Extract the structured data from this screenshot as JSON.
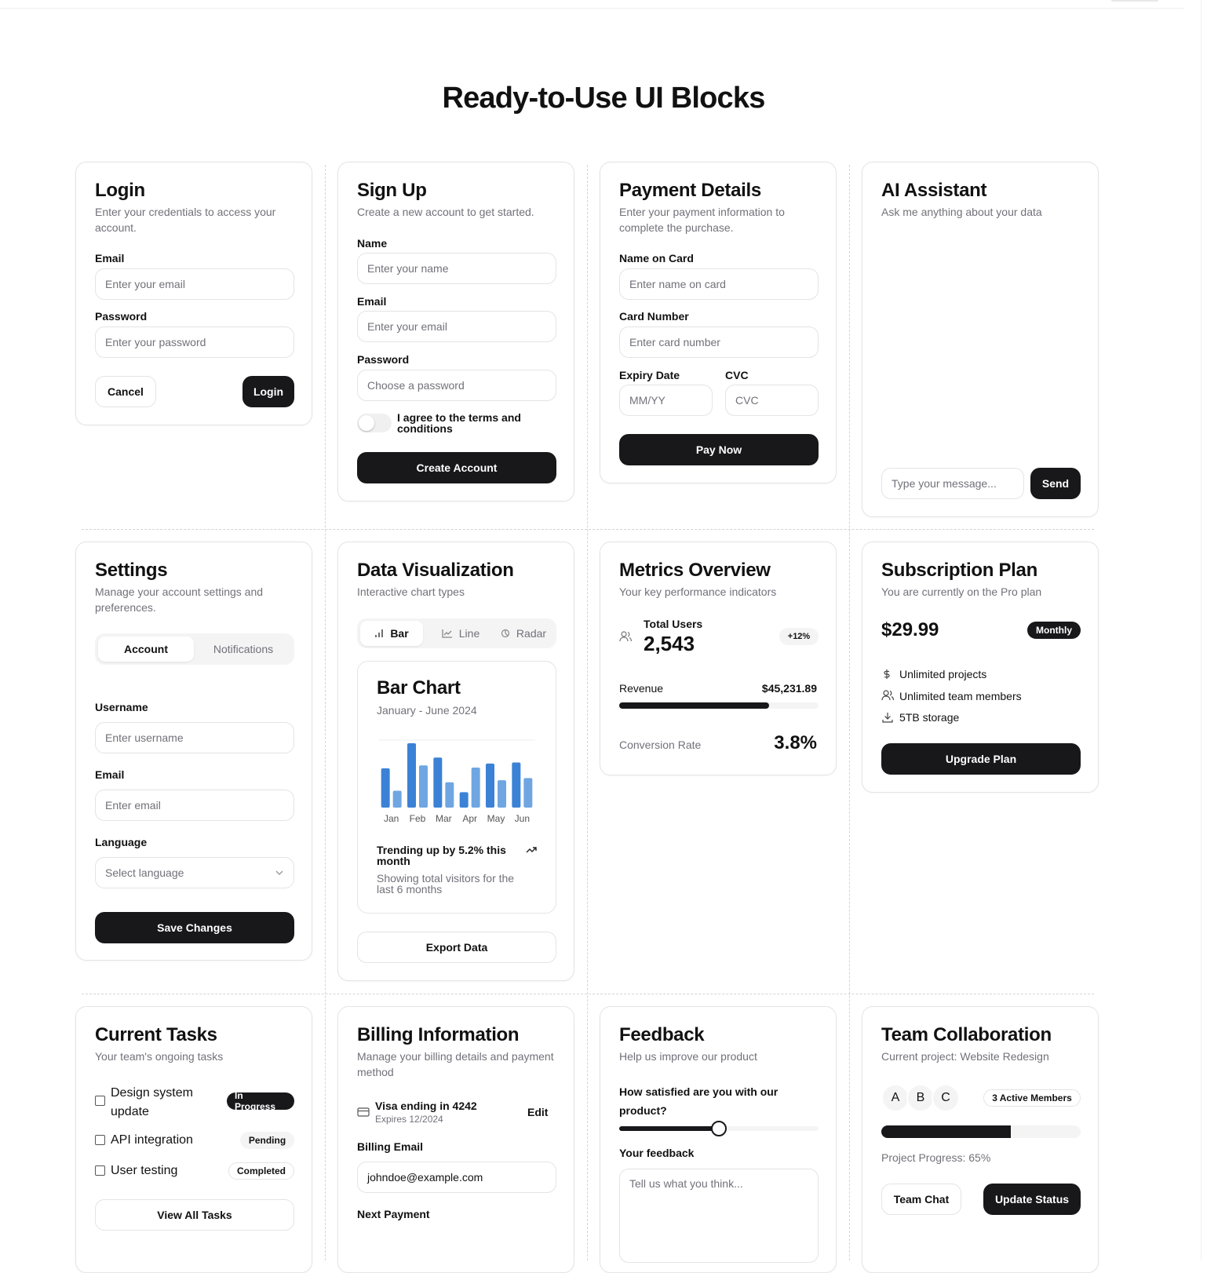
{
  "page": {
    "title": "Ready-to-Use UI Blocks"
  },
  "login": {
    "title": "Login",
    "subtitle": "Enter your credentials to access your account.",
    "email_label": "Email",
    "email_placeholder": "Enter your email",
    "password_label": "Password",
    "password_placeholder": "Enter your password",
    "cancel_label": "Cancel",
    "login_label": "Login"
  },
  "signup": {
    "title": "Sign Up",
    "subtitle": "Create a new account to get started.",
    "name_label": "Name",
    "name_placeholder": "Enter your name",
    "email_label": "Email",
    "email_placeholder": "Enter your email",
    "password_label": "Password",
    "password_placeholder": "Choose a password",
    "terms_label": "I agree to the terms and conditions",
    "terms_checked": false,
    "create_label": "Create Account"
  },
  "payment": {
    "title": "Payment Details",
    "subtitle": "Enter your payment information to complete the purchase.",
    "name_label": "Name on Card",
    "name_placeholder": "Enter name on card",
    "card_label": "Card Number",
    "card_placeholder": "Enter card number",
    "expiry_label": "Expiry Date",
    "expiry_placeholder": "MM/YY",
    "cvc_label": "CVC",
    "cvc_placeholder": "CVC",
    "pay_label": "Pay Now"
  },
  "ai": {
    "title": "AI Assistant",
    "subtitle": "Ask me anything about your data",
    "message_placeholder": "Type your message...",
    "send_label": "Send"
  },
  "settings": {
    "title": "Settings",
    "subtitle": "Manage your account settings and preferences.",
    "tabs": [
      {
        "label": "Account",
        "active": true
      },
      {
        "label": "Notifications",
        "active": false
      }
    ],
    "username_label": "Username",
    "username_placeholder": "Enter username",
    "email_label": "Email",
    "email_placeholder": "Enter email",
    "language_label": "Language",
    "language_placeholder": "Select language",
    "save_label": "Save Changes"
  },
  "dataviz": {
    "title": "Data Visualization",
    "subtitle": "Interactive chart types",
    "tabs": [
      {
        "label": "Bar",
        "icon": "bar-chart-icon",
        "active": true
      },
      {
        "label": "Line",
        "icon": "line-chart-icon",
        "active": false
      },
      {
        "label": "Radar",
        "icon": "radar-icon",
        "active": false
      }
    ],
    "chart_title": "Bar Chart",
    "chart_subtitle": "January - June 2024",
    "trend_text": "Trending up by 5.2% this month",
    "footer_text": "Showing total visitors for the last 6 months",
    "export_label": "Export Data",
    "colors": {
      "primary": "#3b82d6",
      "secondary": "#6fa6e2"
    }
  },
  "chart_data": {
    "type": "bar",
    "categories": [
      "Jan",
      "Feb",
      "Mar",
      "Apr",
      "May",
      "Jun"
    ],
    "series": [
      {
        "values": [
          186,
          305,
          237,
          73,
          209,
          214
        ]
      },
      {
        "values": [
          80,
          200,
          120,
          190,
          130,
          140
        ]
      }
    ],
    "title": "Bar Chart",
    "subtitle": "January - June 2024",
    "ylim": [
      0,
      320
    ],
    "grid": true
  },
  "metrics": {
    "title": "Metrics Overview",
    "subtitle": "Your key performance indicators",
    "users_label": "Total Users",
    "users_value": "2,543",
    "users_change": "+12%",
    "revenue_label": "Revenue",
    "revenue_value": "$45,231.89",
    "revenue_progress": 0.75,
    "conversion_label": "Conversion Rate",
    "conversion_value": "3.8%"
  },
  "subscription": {
    "title": "Subscription Plan",
    "subtitle": "You are currently on the Pro plan",
    "price": "$29.99",
    "period_badge": "Monthly",
    "features": [
      {
        "icon": "dollar-icon",
        "text": "Unlimited projects"
      },
      {
        "icon": "users-icon",
        "text": "Unlimited team members"
      },
      {
        "icon": "download-icon",
        "text": "5TB storage"
      }
    ],
    "upgrade_label": "Upgrade Plan"
  },
  "tasks": {
    "title": "Current Tasks",
    "subtitle": "Your team's ongoing tasks",
    "items": [
      {
        "name": "Design system update",
        "status": "In Progress"
      },
      {
        "name": "API integration",
        "status": "Pending"
      },
      {
        "name": "User testing",
        "status": "Completed"
      }
    ],
    "view_all_label": "View All Tasks"
  },
  "billing": {
    "title": "Billing Information",
    "subtitle": "Manage your billing details and payment method",
    "card_text": "Visa ending in 4242",
    "card_expiry": "Expires 12/2024",
    "edit_label": "Edit",
    "email_label": "Billing Email",
    "email_value": "johndoe@example.com",
    "next_payment_label": "Next Payment"
  },
  "feedback": {
    "title": "Feedback",
    "subtitle": "Help us improve our product",
    "question": "How satisfied are you with our product?",
    "satisfaction": 0.5,
    "feedback_label": "Your feedback",
    "feedback_placeholder": "Tell us what you think..."
  },
  "team": {
    "title": "Team Collaboration",
    "subtitle": "Current project: Website Redesign",
    "avatars": [
      "A",
      "B",
      "C"
    ],
    "members_badge": "3 Active Members",
    "progress": 0.65,
    "progress_label": "Project Progress: 65%",
    "chat_label": "Team Chat",
    "update_label": "Update Status"
  }
}
